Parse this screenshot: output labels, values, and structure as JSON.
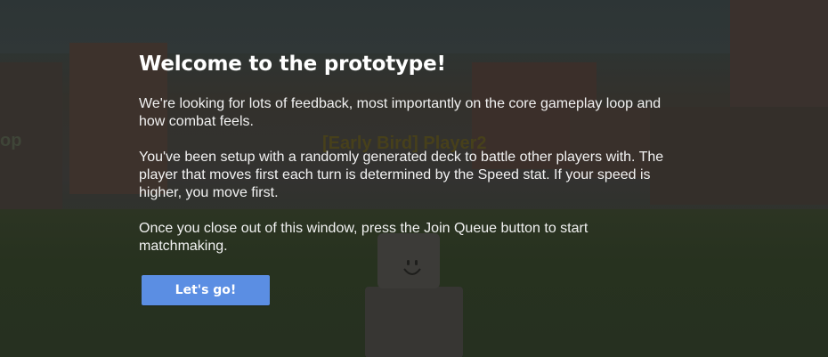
{
  "scene": {
    "player_nametag": "[Early Bird] Player2",
    "side_nametag": "op"
  },
  "modal": {
    "title": "Welcome to the prototype!",
    "paragraph_1": "We're looking for lots of feedback, most importantly on the core gameplay loop and how combat feels.",
    "paragraph_2": "You've been setup with a randomly generated deck to battle other players with. The player that moves first each turn is determined by the Speed stat. If your speed is higher, you move first.",
    "paragraph_3": "Once you close out of this window, press the Join Queue button to start matchmaking.",
    "button_label": "Let's go!"
  },
  "colors": {
    "button": "#5b8ee3",
    "text": "#ffffff",
    "overlay": "#2f302e"
  }
}
